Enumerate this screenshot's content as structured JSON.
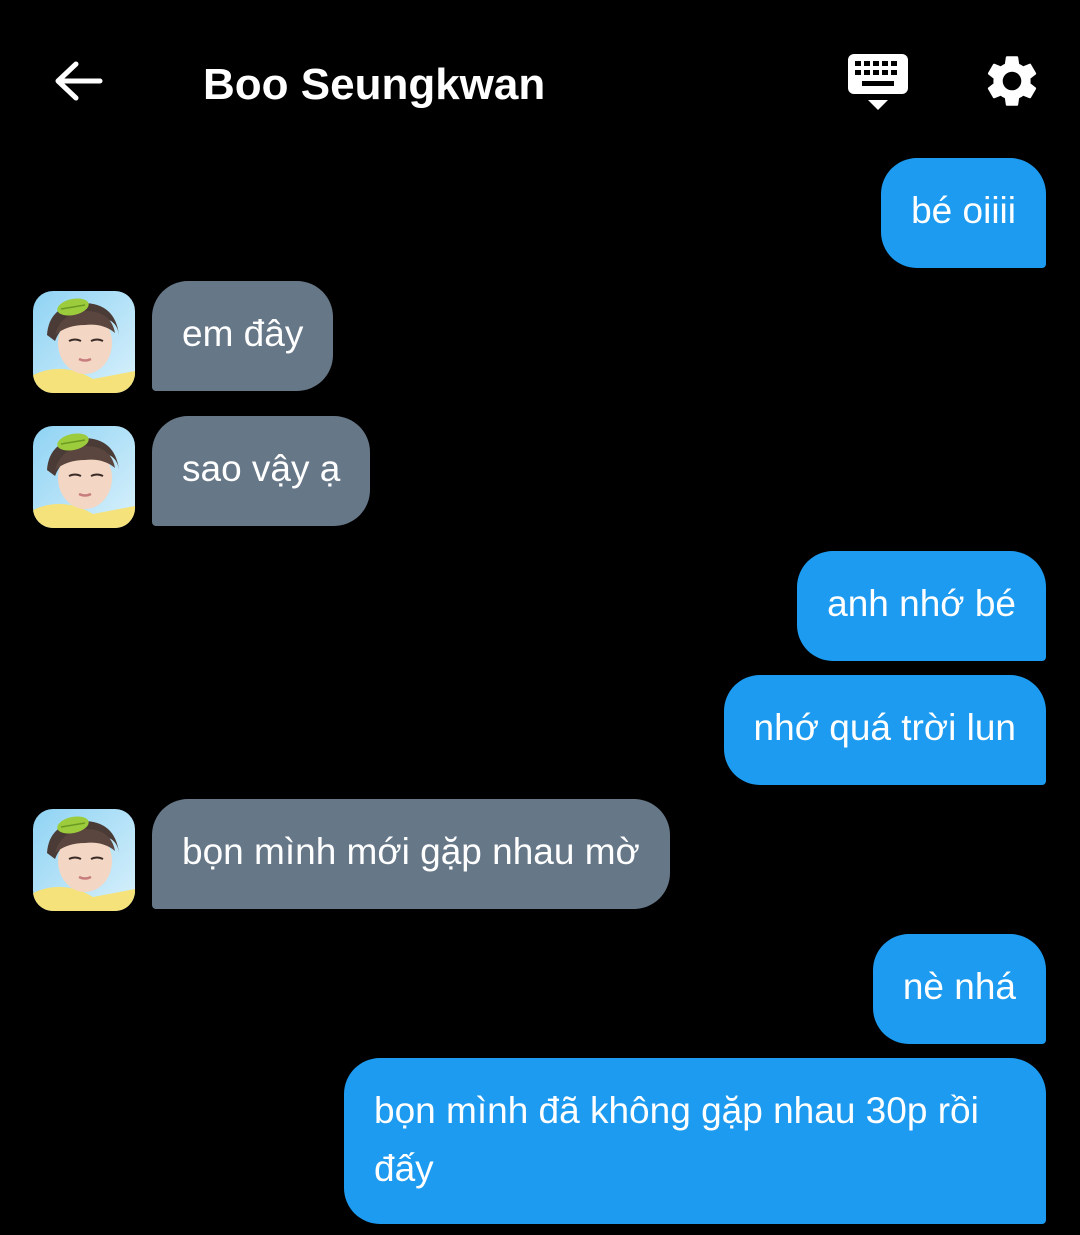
{
  "header": {
    "title": "Boo Seungkwan",
    "back_icon": "arrow-left-icon",
    "keyboard_icon": "keyboard-icon",
    "settings_icon": "gear-icon"
  },
  "colors": {
    "background": "#000000",
    "outgoing_bubble": "#1d9bf0",
    "incoming_bubble": "#667788",
    "text": "#ffffff"
  },
  "messages": [
    {
      "direction": "outgoing",
      "text": "bé oiiii"
    },
    {
      "direction": "incoming",
      "text": "em đây",
      "avatar_icon": "contact-avatar"
    },
    {
      "direction": "incoming",
      "text": "sao vậy ạ",
      "avatar_icon": "contact-avatar"
    },
    {
      "direction": "outgoing",
      "text": "anh nhớ bé"
    },
    {
      "direction": "outgoing",
      "text": "nhớ quá trời lun"
    },
    {
      "direction": "incoming",
      "text": "bọn mình mới gặp nhau mờ",
      "avatar_icon": "contact-avatar"
    },
    {
      "direction": "outgoing",
      "text": "nè nhá"
    },
    {
      "direction": "outgoing",
      "text": "bọn mình đã không gặp nhau 30p rồi đấy"
    }
  ]
}
